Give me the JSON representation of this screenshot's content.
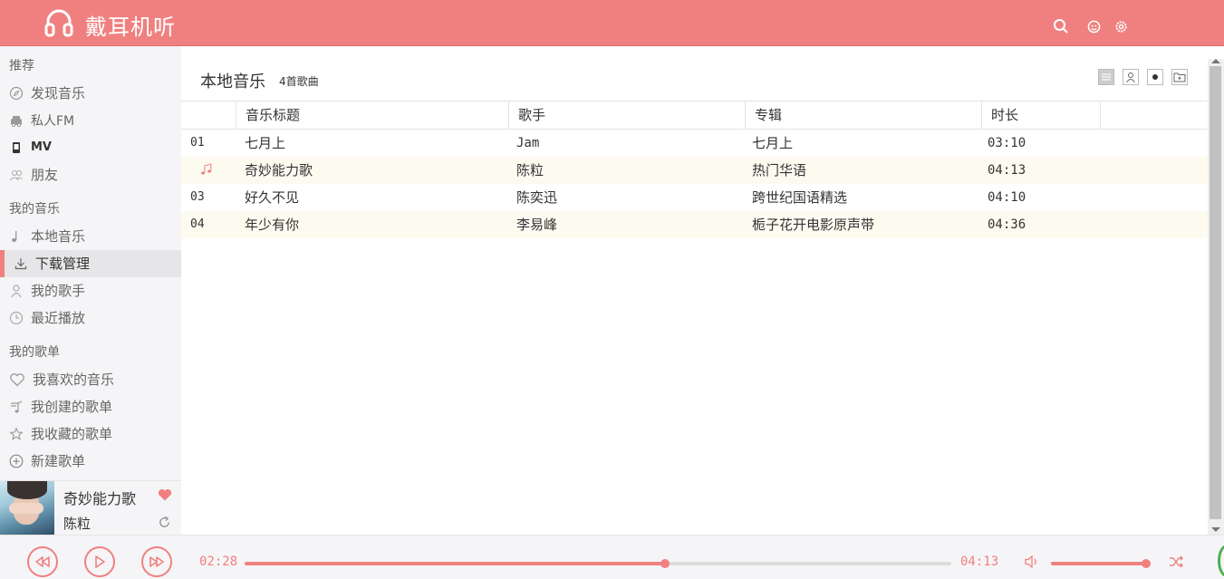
{
  "header": {
    "app_title": "戴耳机听",
    "icons": [
      "headphones-icon",
      "search-icon",
      "user-icon",
      "gear-icon"
    ]
  },
  "sidebar": {
    "sections": [
      {
        "title": "推荐",
        "items": [
          {
            "label": "发现音乐",
            "icon": "compass-icon"
          },
          {
            "label": "私人FM",
            "icon": "radio-icon"
          },
          {
            "label": "MV",
            "icon": "phone-icon"
          },
          {
            "label": "朋友",
            "icon": "friends-icon"
          }
        ]
      },
      {
        "title": "我的音乐",
        "items": [
          {
            "label": "本地音乐",
            "icon": "note-icon"
          },
          {
            "label": "下载管理",
            "icon": "download-icon",
            "active": true
          },
          {
            "label": "我的歌手",
            "icon": "person-icon"
          },
          {
            "label": "最近播放",
            "icon": "clock-icon"
          }
        ]
      },
      {
        "title": "我的歌单",
        "items": [
          {
            "label": "我喜欢的音乐",
            "icon": "heart-icon"
          },
          {
            "label": "我创建的歌单",
            "icon": "playlist-icon"
          },
          {
            "label": "我收藏的歌单",
            "icon": "star-icon"
          },
          {
            "label": "新建歌单",
            "icon": "plus-circle-icon"
          }
        ]
      }
    ]
  },
  "now_playing": {
    "title": "奇妙能力歌",
    "artist": "陈粒"
  },
  "main": {
    "title": "本地音乐",
    "count": "4首歌曲",
    "columns": [
      "音乐标题",
      "歌手",
      "专辑",
      "时长"
    ],
    "rows": [
      {
        "num": "01",
        "title": "七月上",
        "artist": "Jam",
        "album": "七月上",
        "duration": "03:10"
      },
      {
        "num": "",
        "playing": true,
        "title": "奇妙能力歌",
        "artist": "陈粒",
        "album": "热门华语",
        "duration": "04:13"
      },
      {
        "num": "03",
        "title": "好久不见",
        "artist": "陈奕迅",
        "album": "跨世纪国语精选",
        "duration": "04:10"
      },
      {
        "num": "04",
        "title": "年少有你",
        "artist": "李易峰",
        "album": "栀子花开电影原声带",
        "duration": "04:36"
      }
    ]
  },
  "player": {
    "current_time": "02:28",
    "total_time": "04:13",
    "progress_fraction": 0.595,
    "volume_fraction": 0.95,
    "accent": "#f08080"
  }
}
